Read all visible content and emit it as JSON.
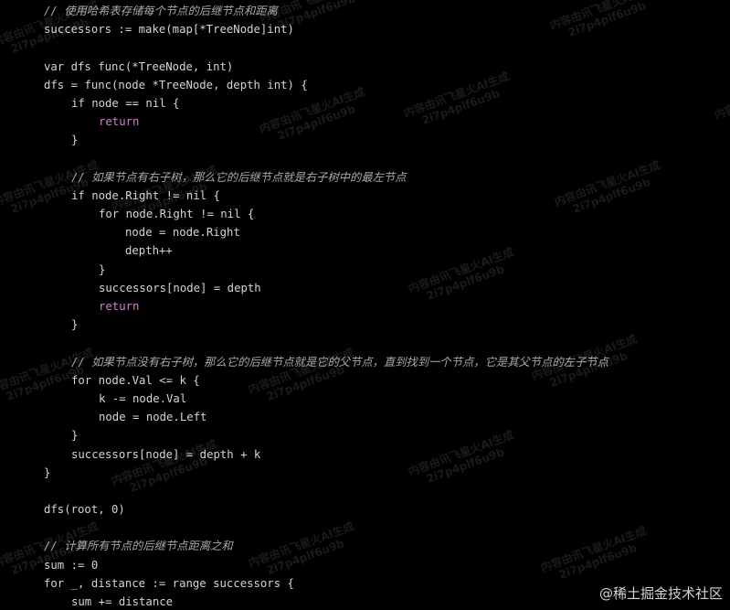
{
  "code": {
    "lines": [
      {
        "indent": 0,
        "tokens": [
          {
            "text": "// 使用哈希表存储每个节点的后继节点和距离",
            "kind": "cmt"
          }
        ]
      },
      {
        "indent": 0,
        "tokens": [
          {
            "text": "successors := make(map[*TreeNode]int)",
            "kind": "plain"
          }
        ]
      },
      {
        "indent": 0,
        "tokens": []
      },
      {
        "indent": 0,
        "tokens": [
          {
            "text": "var dfs func(*TreeNode, int)",
            "kind": "plain"
          }
        ]
      },
      {
        "indent": 0,
        "tokens": [
          {
            "text": "dfs = func(node *TreeNode, depth int) {",
            "kind": "plain"
          }
        ]
      },
      {
        "indent": 1,
        "tokens": [
          {
            "text": "if node == nil {",
            "kind": "plain"
          }
        ]
      },
      {
        "indent": 2,
        "tokens": [
          {
            "text": "return",
            "kind": "kw"
          }
        ]
      },
      {
        "indent": 1,
        "tokens": [
          {
            "text": "}",
            "kind": "plain"
          }
        ]
      },
      {
        "indent": 0,
        "tokens": []
      },
      {
        "indent": 1,
        "tokens": [
          {
            "text": "// 如果节点有右子树，那么它的后继节点就是右子树中的最左节点",
            "kind": "cmt"
          }
        ]
      },
      {
        "indent": 1,
        "tokens": [
          {
            "text": "if node.Right != nil {",
            "kind": "plain"
          }
        ]
      },
      {
        "indent": 2,
        "tokens": [
          {
            "text": "for node.Right != nil {",
            "kind": "plain"
          }
        ]
      },
      {
        "indent": 3,
        "tokens": [
          {
            "text": "node = node.Right",
            "kind": "plain"
          }
        ]
      },
      {
        "indent": 3,
        "tokens": [
          {
            "text": "depth++",
            "kind": "plain"
          }
        ]
      },
      {
        "indent": 2,
        "tokens": [
          {
            "text": "}",
            "kind": "plain"
          }
        ]
      },
      {
        "indent": 2,
        "tokens": [
          {
            "text": "successors[node] = depth",
            "kind": "plain"
          }
        ]
      },
      {
        "indent": 2,
        "tokens": [
          {
            "text": "return",
            "kind": "kw"
          }
        ]
      },
      {
        "indent": 1,
        "tokens": [
          {
            "text": "}",
            "kind": "plain"
          }
        ]
      },
      {
        "indent": 0,
        "tokens": []
      },
      {
        "indent": 1,
        "tokens": [
          {
            "text": "// 如果节点没有右子树，那么它的后继节点就是它的父节点，直到找到一个节点，它是其父节点的左子节点",
            "kind": "cmt"
          }
        ]
      },
      {
        "indent": 1,
        "tokens": [
          {
            "text": "for node.Val <= k {",
            "kind": "plain"
          }
        ]
      },
      {
        "indent": 2,
        "tokens": [
          {
            "text": "k -= node.Val",
            "kind": "plain"
          }
        ]
      },
      {
        "indent": 2,
        "tokens": [
          {
            "text": "node = node.Left",
            "kind": "plain"
          }
        ]
      },
      {
        "indent": 1,
        "tokens": [
          {
            "text": "}",
            "kind": "plain"
          }
        ]
      },
      {
        "indent": 1,
        "tokens": [
          {
            "text": "successors[node] = depth + k",
            "kind": "plain"
          }
        ]
      },
      {
        "indent": 0,
        "tokens": [
          {
            "text": "}",
            "kind": "plain"
          }
        ]
      },
      {
        "indent": 0,
        "tokens": []
      },
      {
        "indent": 0,
        "tokens": [
          {
            "text": "dfs(root, 0)",
            "kind": "plain"
          }
        ]
      },
      {
        "indent": 0,
        "tokens": []
      },
      {
        "indent": 0,
        "tokens": [
          {
            "text": "// 计算所有节点的后继节点距离之和",
            "kind": "cmt"
          }
        ]
      },
      {
        "indent": 0,
        "tokens": [
          {
            "text": "sum := 0",
            "kind": "plain"
          }
        ]
      },
      {
        "indent": 0,
        "tokens": [
          {
            "text": "for _, distance := range successors {",
            "kind": "plain"
          }
        ]
      },
      {
        "indent": 1,
        "tokens": [
          {
            "text": "sum += distance",
            "kind": "plain"
          }
        ]
      }
    ]
  },
  "watermark": {
    "line1": "内容由讯飞星火AI生成",
    "line2": "2i7p4plf6u9b"
  },
  "brand": {
    "text": "@稀土掘金技术社区"
  },
  "colors": {
    "background": "#000000",
    "code_text": "#d4d4d4",
    "comment": "#a8a8a8",
    "keyword": "#c586c0"
  }
}
